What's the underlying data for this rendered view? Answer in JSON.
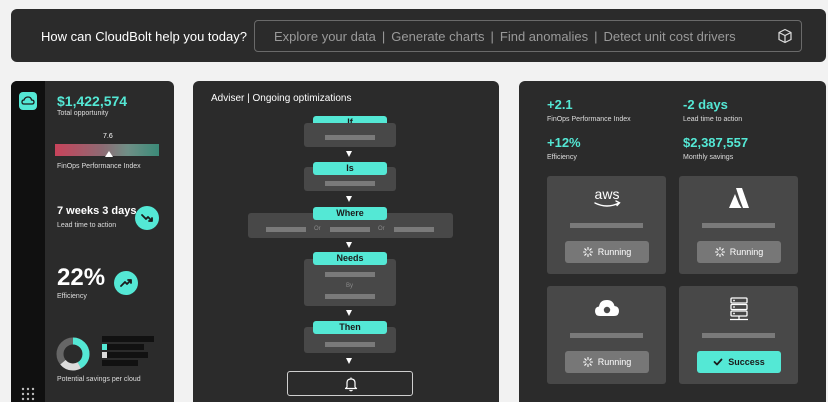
{
  "topbar": {
    "prompt": "How can CloudBolt help you today?",
    "suggestions": [
      "Explore your data",
      "Generate charts",
      "Find anomalies",
      "Detect unit cost drivers"
    ],
    "separator": "|"
  },
  "left": {
    "total_opportunity": "$1,422,574",
    "total_opportunity_label": "Total opportunity",
    "fpi_value": "7.6",
    "fpi_label": "FinOps Performance Index",
    "lead_time": "7 weeks 3 days",
    "lead_time_label": "Lead time to action",
    "efficiency": "22%",
    "efficiency_label": "Efficiency",
    "savings_label": "Potential savings per cloud"
  },
  "middle": {
    "title": "Adviser | Ongoing optimizations",
    "steps": [
      "If",
      "Is",
      "Where",
      "Needs",
      "Then"
    ],
    "or": "Or",
    "by": "By"
  },
  "right": {
    "stats": [
      {
        "value": "+2.1",
        "label": "FinOps Performance Index"
      },
      {
        "value": "-2 days",
        "label": "Lead time to action"
      },
      {
        "value": "+12%",
        "label": "Efficiency"
      },
      {
        "value": "$2,387,557",
        "label": "Monthly savings"
      }
    ],
    "cards": [
      {
        "provider": "aws",
        "status": "Running"
      },
      {
        "provider": "azure",
        "status": "Running"
      },
      {
        "provider": "google-cloud",
        "status": "Running"
      },
      {
        "provider": "on-prem-server",
        "status": "Success"
      }
    ]
  },
  "colors": {
    "accent": "#54e8d5",
    "panel": "#2b2b2b",
    "box": "#484848"
  }
}
